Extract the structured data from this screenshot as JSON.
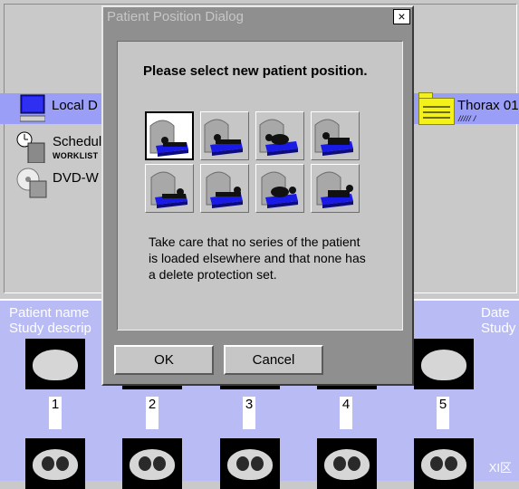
{
  "background": {
    "nav": {
      "local": "Local D",
      "scheduler": "Schedul",
      "scheduler_sub": "WORKLIST",
      "dvd": "DVD-W"
    },
    "patient_folder": {
      "name": "Thorax 01",
      "sub": "///// /"
    },
    "list_header": {
      "left_line1": "Patient name",
      "left_line2": "Study descrip",
      "right_line1": "Date",
      "right_line2": "Study"
    },
    "thumb_numbers": [
      "1",
      "2",
      "3",
      "4",
      "5"
    ],
    "watermark": "XI区"
  },
  "dialog": {
    "title": "Patient Position Dialog",
    "close_label": "×",
    "prompt": "Please select new patient position.",
    "positions": [
      {
        "icon": "head-first-supine-icon",
        "selected": true
      },
      {
        "icon": "head-first-prone-icon",
        "selected": false
      },
      {
        "icon": "head-first-right-decubitus-icon",
        "selected": false
      },
      {
        "icon": "head-first-left-decubitus-icon",
        "selected": false
      },
      {
        "icon": "feet-first-supine-icon",
        "selected": false
      },
      {
        "icon": "feet-first-prone-icon",
        "selected": false
      },
      {
        "icon": "feet-first-right-decubitus-icon",
        "selected": false
      },
      {
        "icon": "feet-first-left-decubitus-icon",
        "selected": false
      }
    ],
    "note": "Take care that no series of the patient is loaded elsewhere and that none has a delete protection set.",
    "ok_label": "OK",
    "cancel_label": "Cancel"
  },
  "colors": {
    "selection_blue": "#9a9ef7",
    "list_background": "#b9bbf4",
    "dialog_gray": "#8f8f8f",
    "panel_gray": "#c6c6c6",
    "table_blue": "#1a1ae6"
  }
}
